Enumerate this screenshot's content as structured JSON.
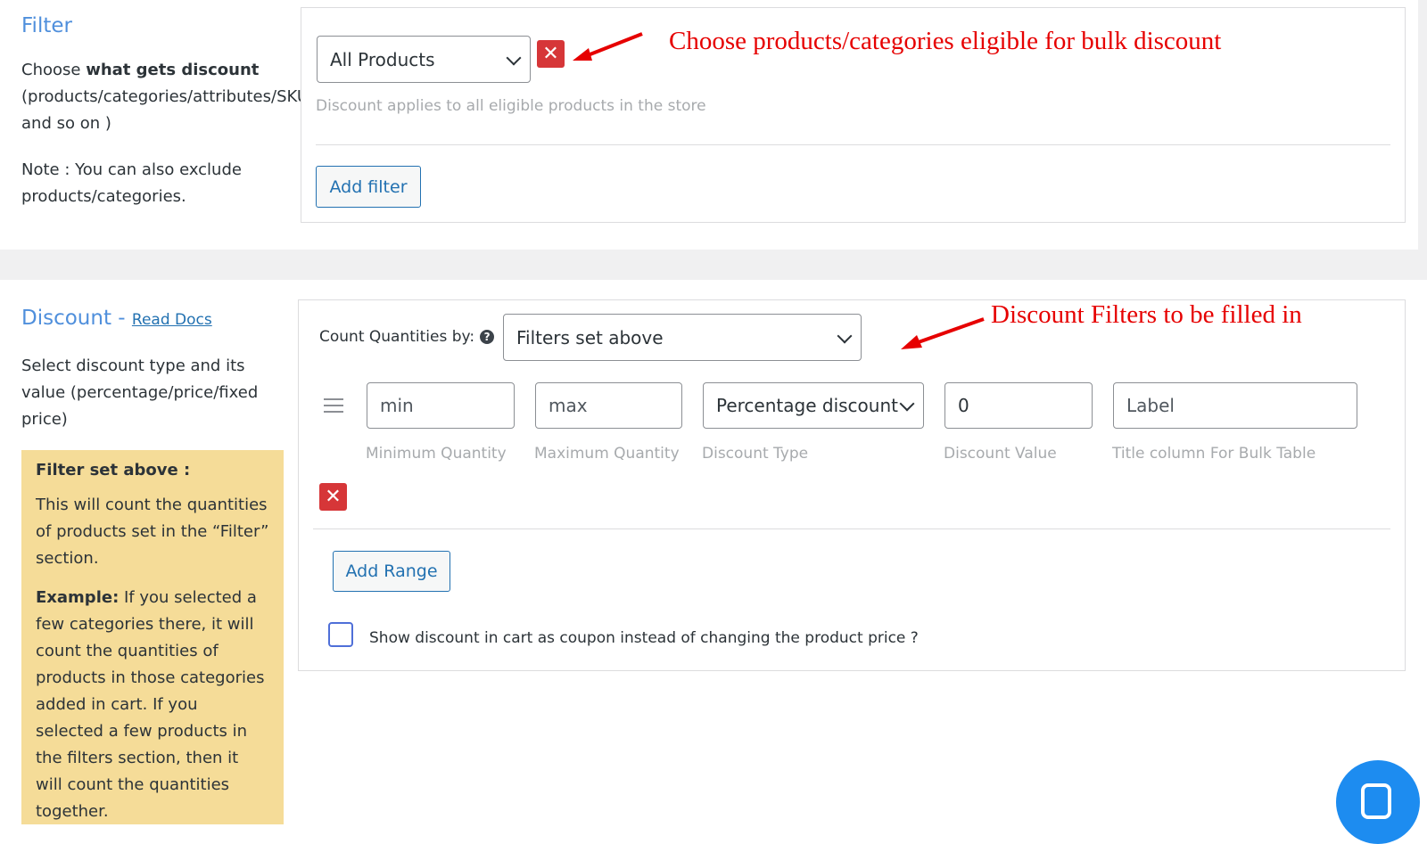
{
  "filter_section": {
    "title": "Filter",
    "desc_prefix": "Choose ",
    "desc_bold": "what gets discount",
    "desc_rest_line2": "(products/categories/attributes/SKU",
    "desc_rest_line3": "and so on )",
    "note_line1": "Note : You can also exclude",
    "note_line2": "products/categories.",
    "select_value": "All Products",
    "hint": "Discount applies to all eligible products in the store",
    "add_filter_label": "Add filter",
    "annotation": "Choose products/categories eligible for bulk discount"
  },
  "discount_section": {
    "title": "Discount - ",
    "read_docs": "Read Docs",
    "desc_line1": "Select discount type and its",
    "desc_line2": "value (percentage/price/fixed",
    "desc_line3": "price)",
    "count_label": "Count Quantities by:",
    "count_value": "Filters set above",
    "annotation": "Discount Filters to be filled in",
    "range": {
      "min_placeholder": "min",
      "max_placeholder": "max",
      "type_value": "Percentage discount",
      "value": "0",
      "label_placeholder": "Label",
      "min_caption": "Minimum Quantity",
      "max_caption": "Maximum Quantity",
      "type_caption": "Discount Type",
      "value_caption": "Discount Value",
      "title_caption": "Title column For Bulk Table"
    },
    "add_range_label": "Add Range",
    "coupon_label": "Show discount in cart as coupon instead of changing the product price ?",
    "coupon_checked": false
  },
  "info_box": {
    "title": "Filter set above :",
    "para1": "This will count the quantities of products set in the “Filter” section.",
    "example_bold": "Example:",
    "example_text": " If you selected a few categories there, it will count the quantities of products in those categories added in cart. If you selected a few products in the filters section, then it will count the quantities together."
  },
  "colors": {
    "accent": "#4f8fdc",
    "link": "#2271b1",
    "danger": "#d63638",
    "annotation": "#e60000",
    "note_bg": "#f5dc98"
  },
  "icons": {
    "remove": "close-icon",
    "select": "chevron-down-icon",
    "help": "help-icon",
    "drag": "drag-handle-icon",
    "chat": "chat-icon"
  }
}
